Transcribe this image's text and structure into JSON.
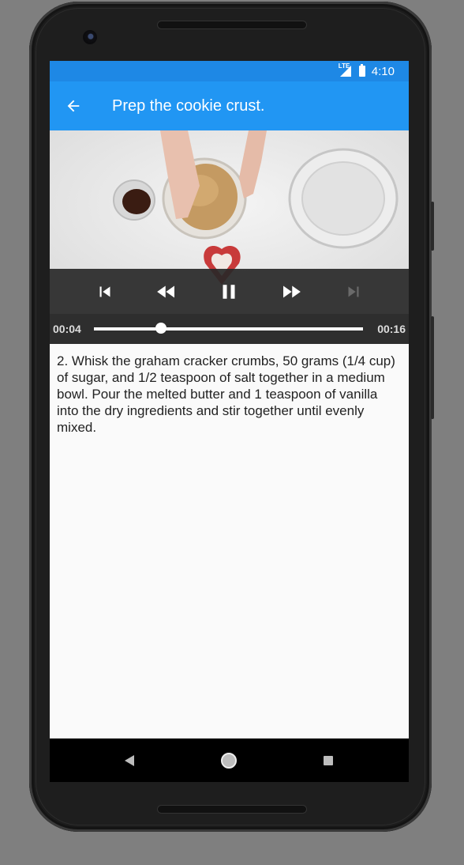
{
  "status_bar": {
    "network": "LTE",
    "time": "4:10",
    "icons": [
      "lte-signal-icon",
      "battery-charging-icon"
    ]
  },
  "app_bar": {
    "title": "Prep the cookie crust.",
    "back_icon": "arrow-back-icon"
  },
  "player": {
    "controls": [
      "skip-previous-icon",
      "rewind-icon",
      "pause-icon",
      "fast-forward-icon",
      "skip-next-icon"
    ],
    "current_time": "00:04",
    "duration": "00:16",
    "progress": 0.25
  },
  "step": {
    "description": "2. Whisk the graham cracker crumbs, 50 grams (1/4 cup) of sugar, and 1/2 teaspoon of salt together in a medium bowl. Pour the melted butter and 1 teaspoon of vanilla into the dry ingredients and stir together until evenly mixed."
  },
  "nav_bar": {
    "icons": [
      "nav-back-icon",
      "nav-home-icon",
      "nav-recents-icon"
    ]
  },
  "colors": {
    "app_bar": "#2196f3",
    "status_bar": "#1e88e5",
    "background": "#fafafa"
  }
}
